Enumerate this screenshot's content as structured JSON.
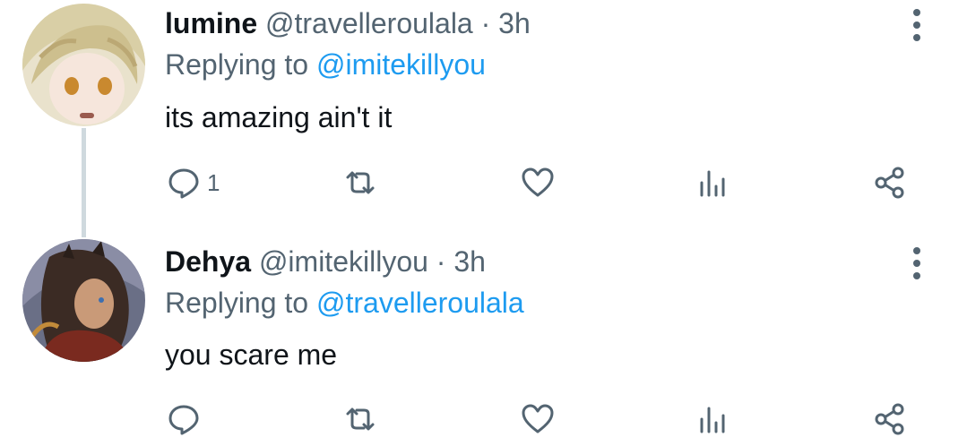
{
  "colors": {
    "text": "#0f1419",
    "secondary": "#536471",
    "link": "#1d9bf0",
    "thread_line": "#cfd9de",
    "icon": "#536471"
  },
  "tweets": [
    {
      "name": "lumine",
      "handle": "@travelleroulala",
      "time": "· 3h",
      "replying_prefix": "Replying to ",
      "replying_to": "@imitekillyou",
      "text": "its amazing ain't it",
      "reply_count": "1",
      "avatar": "avatar-lumine"
    },
    {
      "name": "Dehya",
      "handle": "@imitekillyou",
      "time": "· 3h",
      "replying_prefix": "Replying to ",
      "replying_to": "@travelleroulala",
      "text": "you scare me",
      "reply_count": "",
      "avatar": "avatar-dehya"
    }
  ],
  "icons": [
    "reply-icon",
    "retweet-icon",
    "like-icon",
    "views-icon",
    "share-icon",
    "more-icon"
  ]
}
